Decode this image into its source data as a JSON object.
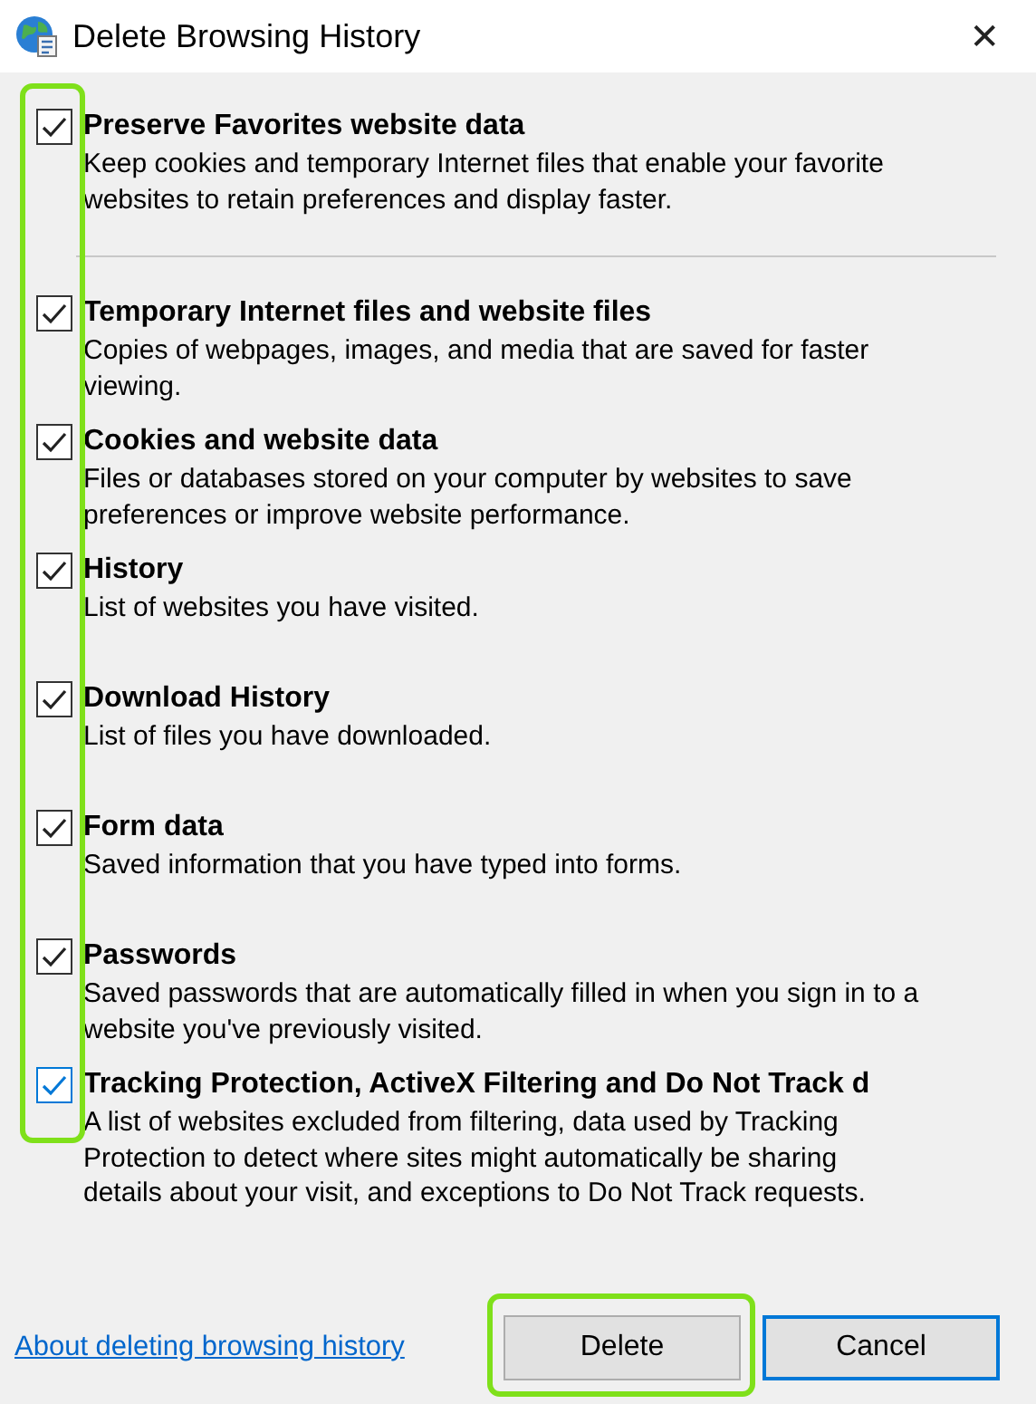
{
  "window": {
    "title": "Delete Browsing History",
    "close": "✕"
  },
  "options": [
    {
      "label": "Preserve Favorites website data",
      "description": "Keep cookies and temporary Internet files that enable your favorite websites to retain preferences and display faster.",
      "checked": true,
      "focused": false
    },
    {
      "label": "Temporary Internet files and website files",
      "description": "Copies of webpages, images, and media that are saved for faster viewing.",
      "checked": true,
      "focused": false
    },
    {
      "label": "Cookies and website data",
      "description": "Files or databases stored on your computer by websites to save preferences or improve website performance.",
      "checked": true,
      "focused": false
    },
    {
      "label": "History",
      "description": "List of websites you have visited.",
      "checked": true,
      "focused": false
    },
    {
      "label": "Download History",
      "description": "List of files you have downloaded.",
      "checked": true,
      "focused": false
    },
    {
      "label": "Form data",
      "description": "Saved information that you have typed into forms.",
      "checked": true,
      "focused": false
    },
    {
      "label": "Passwords",
      "description": "Saved passwords that are automatically filled in when you sign in to a website you've previously visited.",
      "checked": true,
      "focused": false
    },
    {
      "label": "Tracking Protection, ActiveX Filtering and Do Not Track d",
      "description": "A list of websites excluded from filtering, data used by Tracking Protection to detect where sites might automatically be sharing details about your visit, and exceptions to Do Not Track requests.",
      "checked": true,
      "focused": true
    }
  ],
  "footer": {
    "link": "About deleting browsing history",
    "buttons": [
      {
        "label": "Delete",
        "kind": "normal"
      },
      {
        "label": "Cancel",
        "kind": "default"
      }
    ]
  }
}
